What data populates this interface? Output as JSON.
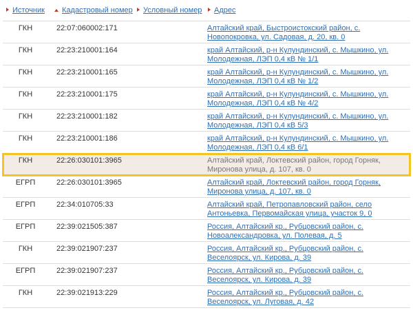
{
  "header": {
    "source": "Источник",
    "cadastral": "Кадастровый номер",
    "conditional": "Условный номер",
    "address": "Адрес"
  },
  "rows": [
    {
      "source": "ГКН",
      "cadastral": "22:07:060002:171",
      "conditional": "",
      "address": "Алтайский край, Быстроистокский район, с. Новопокровка, ул. Садовая, д. 20, кв. 0"
    },
    {
      "source": "ГКН",
      "cadastral": "22:23:210001:164",
      "conditional": "",
      "address": "край Алтайский, р-н Кулундинский, с. Мышкино, ул. Молодежная, ЛЭП 0,4 кВ № 1/1"
    },
    {
      "source": "ГКН",
      "cadastral": "22:23:210001:165",
      "conditional": "",
      "address": "край Алтайский, р-н Кулундинский, с. Мышкино, ул. Молодежная, ЛЭП 0,4 кВ № 1/2"
    },
    {
      "source": "ГКН",
      "cadastral": "22:23:210001:175",
      "conditional": "",
      "address": "край Алтайский, р-н Кулундинский, с. Мышкино, ул. Молодежная, ЛЭП 0,4 кВ № 4/2"
    },
    {
      "source": "ГКН",
      "cadastral": "22:23:210001:182",
      "conditional": "",
      "address": "край Алтайский, р-н Кулундинский, с. Мышкино, ул. Молодежная, ЛЭП 0,4 кВ 5/3"
    },
    {
      "source": "ГКН",
      "cadastral": "22:23:210001:186",
      "conditional": "",
      "address": "край Алтайский, р-н Кулундинский, с. Мышкино, ул. Молодежная, ЛЭП 0,4 кВ 6/1"
    },
    {
      "source": "ГКН",
      "cadastral": "22:26:030101:3965",
      "conditional": "",
      "address": "Алтайский край, Локтевский район, город Горняк, Миронова улица, д. 107, кв. 0"
    },
    {
      "source": "ЕГРП",
      "cadastral": "22:26:030101:3965",
      "conditional": "",
      "address": "Алтайский край, Локтевский район, город Горняк, Миронова улица, д. 107, кв. 0"
    },
    {
      "source": "ЕГРП",
      "cadastral": "22:34:010705:33",
      "conditional": "",
      "address": "Алтайский край, Петропавловский район, село Антоньевка, Первомайская улица, участок 9, 0"
    },
    {
      "source": "ЕГРП",
      "cadastral": "22:39:021505:387",
      "conditional": "",
      "address": "Россия, Алтайский кр., Рубцовский район, с. Новоалександровка, ул. Полевая, д. 5"
    },
    {
      "source": "ГКН",
      "cadastral": "22:39:021907:237",
      "conditional": "",
      "address": "Россия, Алтайский кр., Рубцовский район, с. Веселоярск, ул. Кирова, д. 39"
    },
    {
      "source": "ЕГРП",
      "cadastral": "22:39:021907:237",
      "conditional": "",
      "address": "Россия, Алтайский кр., Рубцовский район, с. Веселоярск, ул. Кирова, д. 39"
    },
    {
      "source": "ГКН",
      "cadastral": "22:39:021913:229",
      "conditional": "",
      "address": "Россия, Алтайский кр., Рубцовский район, с. Веселоярск, ул. Луговая, д. 42"
    }
  ],
  "highlighted_row": 6,
  "colors": {
    "link": "#2f6fb4",
    "sort_arrow": "#c0392b",
    "highlight_border": "#f2c521",
    "highlight_bg": "#f3ece6"
  }
}
